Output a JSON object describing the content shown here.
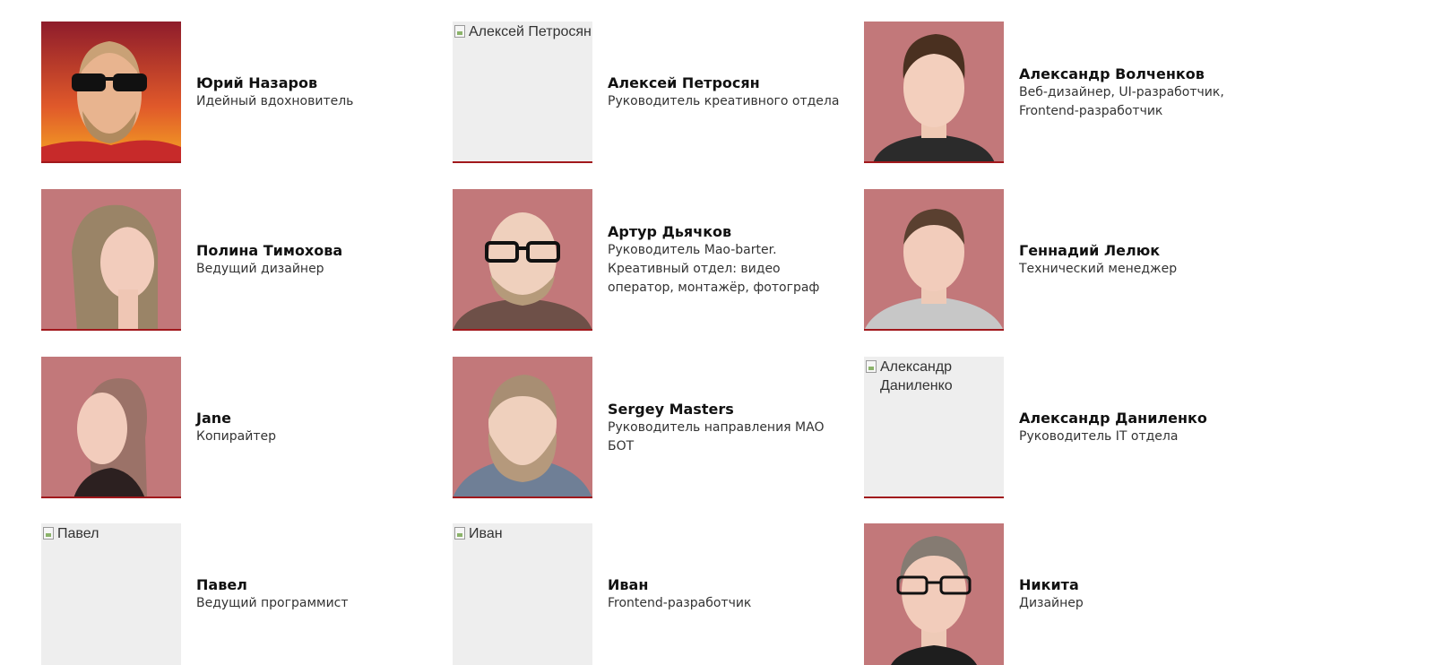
{
  "team": [
    {
      "name": "Юрий Назаров",
      "role": "Идейный вдохновитель",
      "photo": "illustrated-portrait-sunglasses-beard",
      "bg": "#c0392b"
    },
    {
      "name": "Алексей Петросян",
      "role": "Руководитель креативного отдела",
      "photo": "broken-image",
      "alt": "Алексей Петросян"
    },
    {
      "name": "Александр Волченков",
      "role": "Веб-дизайнер, UI-разработчик,\nFrontend-разработчик",
      "photo": "illustrated-portrait-dark-hair"
    },
    {
      "name": "Полина Тимохова",
      "role": "Ведущий дизайнер",
      "photo": "illustrated-portrait-long-hair"
    },
    {
      "name": "Артур Дьячков",
      "role": "Руководитель Mao-barter.\nКреативный отдел: видео\nоператор, монтажёр, фотограф",
      "photo": "illustrated-portrait-glasses-beard"
    },
    {
      "name": "Геннадий Лелюк",
      "role": "Технический менеджер",
      "photo": "illustrated-portrait-short-hair"
    },
    {
      "name": "Jane",
      "role": "Копирайтер",
      "photo": "illustrated-portrait-woman-profile"
    },
    {
      "name": "Sergey Masters",
      "role": "Руководитель направления MAO\nБОТ",
      "photo": "illustrated-portrait-long-beard"
    },
    {
      "name": "Александр Даниленко",
      "role": "Руководитель IT отдела",
      "photo": "broken-image",
      "alt": "Александр Даниленко"
    },
    {
      "name": "Павел",
      "role": "Ведущий программист",
      "photo": "broken-image",
      "alt": "Павел"
    },
    {
      "name": "Иван",
      "role": "Frontend-разработчик",
      "photo": "broken-image",
      "alt": "Иван"
    },
    {
      "name": "Никита",
      "role": "Дизайнер",
      "photo": "illustrated-portrait-glasses-grey-hair"
    }
  ],
  "colors": {
    "photo_bg": "#c2787a",
    "accent_line": "#a1181c",
    "placeholder_bg": "#eeeeee"
  }
}
